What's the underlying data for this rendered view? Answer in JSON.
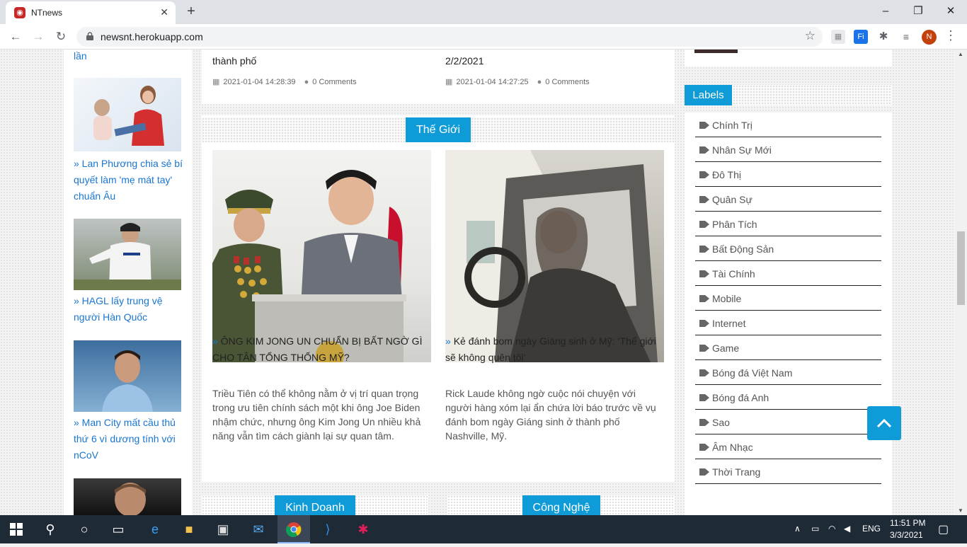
{
  "browser": {
    "tab_title": "NTnews",
    "url": "newsnt.herokuapp.com",
    "avatar_letter": "N"
  },
  "left_sidebar": {
    "items": [
      {
        "title": "lần"
      },
      {
        "title": "» Lan Phương chia sẻ bí quyết làm 'mẹ mát tay' chuẩn Âu"
      },
      {
        "title": "» HAGL lấy trung vệ người Hàn Quốc"
      },
      {
        "title": "» Man City mất cầu thủ thứ 6 vì dương tính với nCoV"
      }
    ]
  },
  "top_articles": [
    {
      "title": "thành phố",
      "date": "2021-01-04 14:28:39",
      "comments": "0 Comments"
    },
    {
      "title": "2/2/2021",
      "date": "2021-01-04 14:27:25",
      "comments": "0 Comments"
    }
  ],
  "world": {
    "label": "Thế Giới",
    "articles": [
      {
        "title": "ÔNG KIM JONG UN CHUẨN BỊ BẤT NGỜ GÌ CHO TÂN TỔNG THỐNG MỸ?",
        "desc": "Triều Tiên có thể không nằm ở vị trí quan trọng trong ưu tiên chính sách một khi ông Joe Biden nhậm chức, nhưng ông Kim Jong Un nhiều khả năng vẫn tìm cách giành lại sự quan tâm."
      },
      {
        "title": "Kẻ đánh bom ngày Giáng sinh ở Mỹ: ‘Thế giới sẽ không quên tôi’",
        "desc": "Rick Laude không ngờ cuộc nói chuyện với người hàng xóm lại ẩn chứa lời báo trước về vụ đánh bom ngày Giáng sinh ở thành phố Nashville, Mỹ."
      }
    ]
  },
  "sections": {
    "business": "Kinh Doanh",
    "tech": "Công Nghệ"
  },
  "labels": {
    "heading": "Labels",
    "items": [
      "Chính Trị",
      "Nhân Sự Mới",
      "Đô Thị",
      "Quân Sự",
      "Phân Tích",
      "Bất Động Sản",
      "Tài Chính",
      "Mobile",
      "Internet",
      "Game",
      "Bóng đá Việt Nam",
      "Bóng đá Anh",
      "Sao",
      "Âm Nhạc",
      "Thời Trang"
    ]
  },
  "taskbar": {
    "lang": "ENG",
    "time": "11:51 PM",
    "date": "3/3/2021"
  },
  "colors": {
    "accent": "#0e9bd8",
    "link": "#1976d2"
  }
}
